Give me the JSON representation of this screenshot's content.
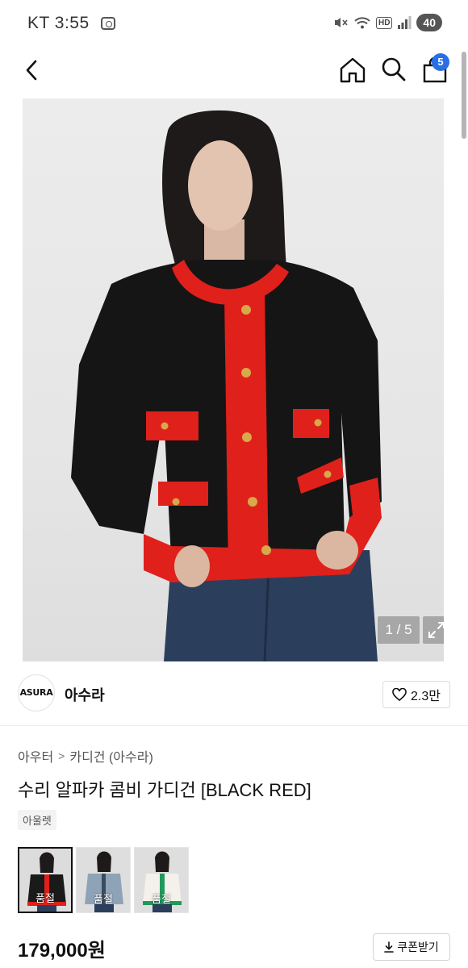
{
  "status_bar": {
    "carrier_time": "KT 3:55",
    "network_badge": "HD",
    "battery": "40",
    "icons": [
      "mute-icon",
      "wifi-icon",
      "signal-icon"
    ]
  },
  "nav": {
    "back_icon": "chevron-left-icon",
    "home_icon": "home-icon",
    "search_icon": "search-icon",
    "bag_icon": "shopping-bag-icon",
    "cart_count": "5"
  },
  "gallery": {
    "counter": "1 / 5",
    "expand_icon": "expand-icon"
  },
  "brand": {
    "logo_text": "ASURA",
    "name": "아수라",
    "likes": "2.3만",
    "like_icon": "heart-icon"
  },
  "product": {
    "breadcrumb": [
      "아우터",
      "카디건 (아수라)"
    ],
    "breadcrumb_separator": ">",
    "title": "수리 알파카 콤비 가디건 [BLACK RED]",
    "tag": "아울렛",
    "variants": [
      {
        "label": "품절",
        "colors": {
          "body": "#1a1a1a",
          "trim": "#e0201a"
        }
      },
      {
        "label": "품절",
        "colors": {
          "body": "#8fa3b8",
          "trim": "#3b4b5e"
        }
      },
      {
        "label": "품절",
        "colors": {
          "body": "#f3f1ea",
          "trim": "#1f9a5a"
        }
      }
    ],
    "price": "179,000원",
    "coupon_label": "쿠폰받기",
    "coupon_icon": "download-icon"
  },
  "colors": {
    "accent_blue": "#2670e8",
    "cardigan_black": "#151515",
    "cardigan_red": "#e0201a"
  }
}
